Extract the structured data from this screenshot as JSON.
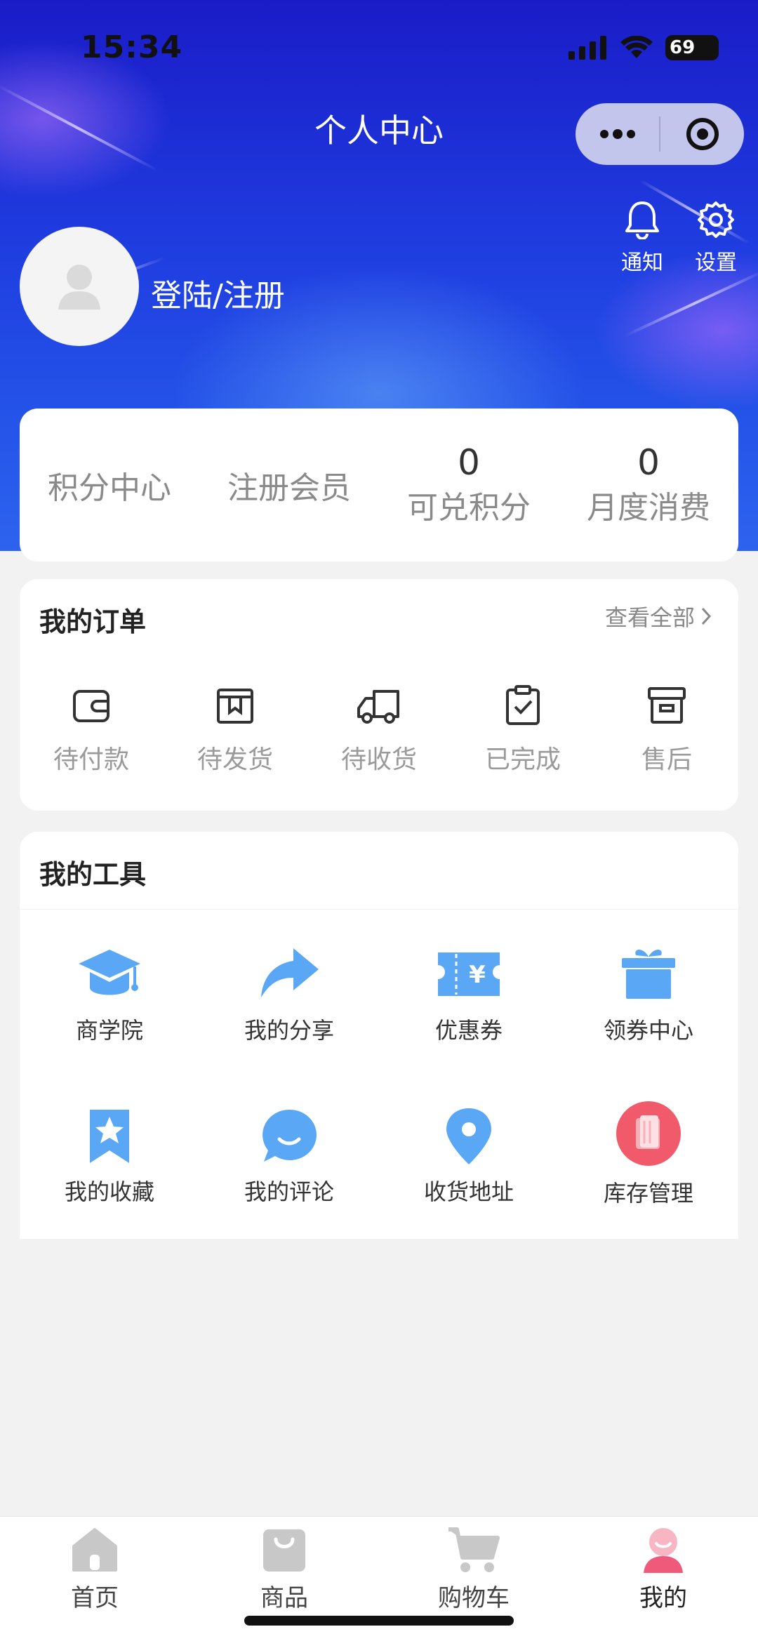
{
  "status_bar": {
    "time": "15:34",
    "battery": "69"
  },
  "header": {
    "title": "个人中心",
    "notify_label": "通知",
    "settings_label": "设置"
  },
  "user": {
    "login_label": "登陆/注册"
  },
  "stats": {
    "points_center": "积分中心",
    "register_member": "注册会员",
    "redeemable_points_value": "0",
    "redeemable_points_label": "可兑积分",
    "monthly_spend_value": "0",
    "monthly_spend_label": "月度消费"
  },
  "orders": {
    "title": "我的订单",
    "view_all": "查看全部",
    "items": [
      {
        "label": "待付款",
        "icon": "wallet-icon"
      },
      {
        "label": "待发货",
        "icon": "box-icon"
      },
      {
        "label": "待收货",
        "icon": "truck-icon"
      },
      {
        "label": "已完成",
        "icon": "clipboard-check-icon"
      },
      {
        "label": "售后",
        "icon": "archive-icon"
      }
    ]
  },
  "tools": {
    "title": "我的工具",
    "items": [
      {
        "label": "商学院",
        "icon": "graduation-cap-icon"
      },
      {
        "label": "我的分享",
        "icon": "share-arrow-icon"
      },
      {
        "label": "优惠券",
        "icon": "coupon-icon"
      },
      {
        "label": "领券中心",
        "icon": "gift-icon"
      },
      {
        "label": "我的收藏",
        "icon": "star-bookmark-icon"
      },
      {
        "label": "我的评论",
        "icon": "comment-bubble-icon"
      },
      {
        "label": "收货地址",
        "icon": "location-pin-icon"
      },
      {
        "label": "库存管理",
        "icon": "inventory-icon"
      }
    ]
  },
  "tabbar": {
    "items": [
      {
        "label": "首页",
        "icon": "home-icon"
      },
      {
        "label": "商品",
        "icon": "shopping-bag-icon"
      },
      {
        "label": "购物车",
        "icon": "cart-icon"
      },
      {
        "label": "我的",
        "icon": "profile-icon"
      }
    ],
    "active_index": 3
  },
  "colors": {
    "accent_blue": "#5aa8f5",
    "active_pink": "#f05a7a",
    "hero_blue": "#1f3de0"
  }
}
